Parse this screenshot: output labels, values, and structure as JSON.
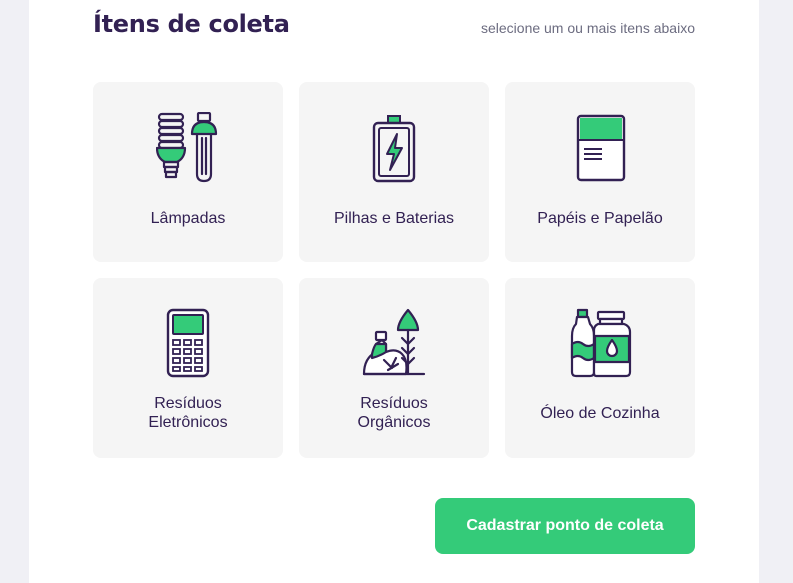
{
  "header": {
    "title": "Ítens de coleta",
    "subtitle": "selecione um ou mais itens abaixo"
  },
  "items": [
    {
      "label": "Lâmpadas",
      "icon": "lamps-icon"
    },
    {
      "label": "Pilhas e Baterias",
      "icon": "battery-icon"
    },
    {
      "label": "Papéis e Papelão",
      "icon": "paper-icon"
    },
    {
      "label_line1": "Resíduos",
      "label_line2": "Eletrônicos",
      "icon": "electronics-icon"
    },
    {
      "label_line1": "Resíduos",
      "label_line2": "Orgânicos",
      "icon": "organic-waste-icon"
    },
    {
      "label": "Óleo de Cozinha",
      "icon": "cooking-oil-icon"
    }
  ],
  "submit_button": {
    "label": "Cadastrar ponto de coleta"
  },
  "colors": {
    "primary": "#34CB79",
    "title": "#322153",
    "text_muted": "#6C6C80",
    "card": "#F5F5F5",
    "background": "#F0F0F5"
  }
}
